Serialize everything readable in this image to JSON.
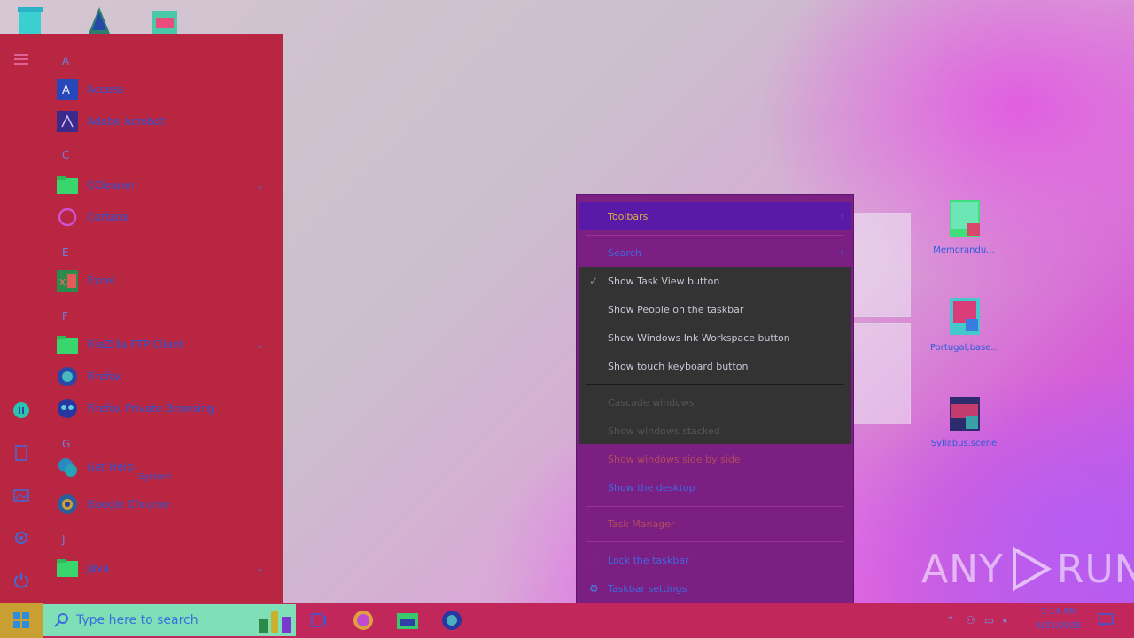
{
  "start_menu": {
    "groups": [
      {
        "letter": "A",
        "apps": [
          {
            "name": "Access"
          },
          {
            "name": "Adobe Acrobat"
          }
        ]
      },
      {
        "letter": "C",
        "apps": [
          {
            "name": "CCleaner",
            "expandable": true
          },
          {
            "name": "Cortana"
          }
        ]
      },
      {
        "letter": "E",
        "apps": [
          {
            "name": "Excel"
          }
        ]
      },
      {
        "letter": "F",
        "apps": [
          {
            "name": "FileZilla FTP Client",
            "expandable": true
          },
          {
            "name": "Firefox"
          },
          {
            "name": "Firefox Private Browsing"
          }
        ]
      },
      {
        "letter": "G",
        "apps": [
          {
            "name": "Get Help",
            "sub": "System"
          },
          {
            "name": "Google Chrome"
          }
        ]
      },
      {
        "letter": "J",
        "apps": [
          {
            "name": "Java",
            "expandable": true
          }
        ]
      }
    ]
  },
  "context_menu": {
    "toolbars": "Toolbars",
    "search": "Search",
    "show_task_view": "Show Task View button",
    "show_people": "Show People on the taskbar",
    "show_ink": "Show Windows Ink Workspace button",
    "show_touch_keyboard": "Show touch keyboard button",
    "cascade": "Cascade windows",
    "stacked": "Show windows stacked",
    "side_by_side": "Show windows side by side",
    "show_desktop": "Show the desktop",
    "task_manager": "Task Manager",
    "lock_taskbar": "Lock the taskbar",
    "taskbar_settings": "Taskbar settings"
  },
  "desktop_icons": {
    "icon1": "Memorandu...",
    "icon2": "Portugal,base...",
    "icon3": "Syllabus.scene"
  },
  "watermark": {
    "text_a": "ANY",
    "text_b": "RUN"
  },
  "taskbar": {
    "search_placeholder": "Type here to search",
    "time": "3:14 AM",
    "date": "6/21/2025"
  },
  "colors": {
    "start_menu_bg": "#b92642",
    "context_menu_bg": "#7c1f83",
    "taskbar_bg": "#c1275a",
    "accent": "#2a56d6"
  }
}
